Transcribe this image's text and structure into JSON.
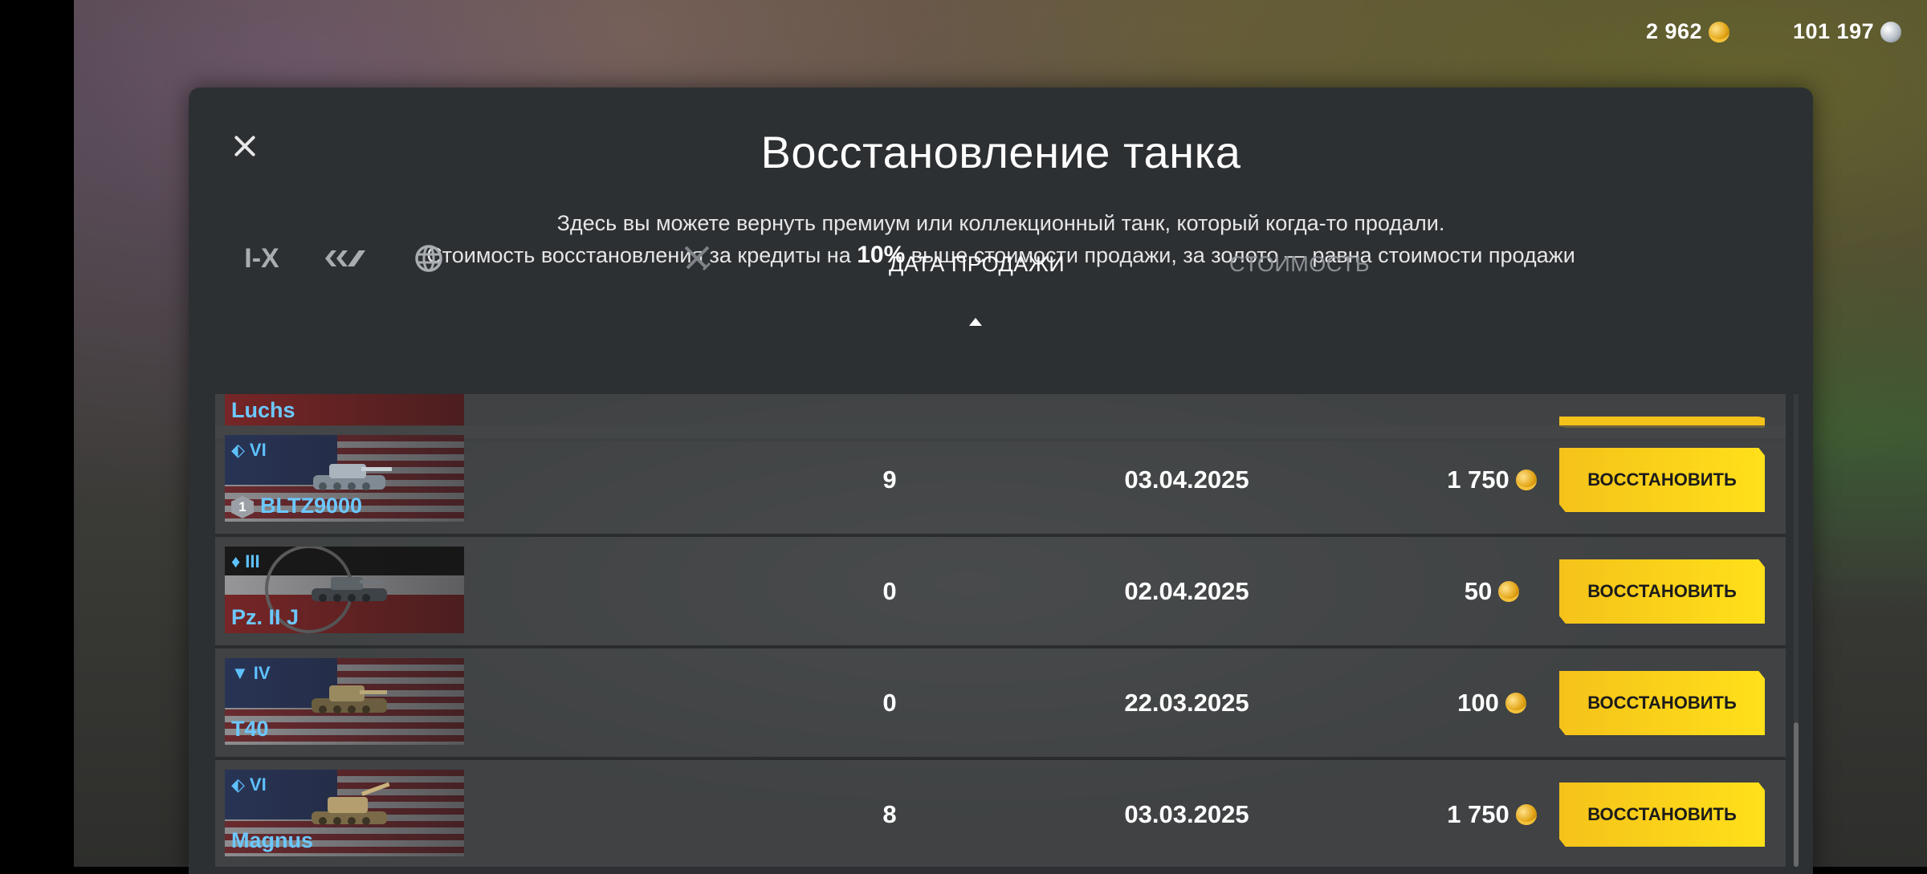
{
  "header": {
    "gold_amount": "2 962",
    "silver_amount": "101 197"
  },
  "dialog": {
    "title": "Восстановление танка",
    "description_line1": "Здесь вы можете вернуть премиум или коллекционный танк, который когда-то продали.",
    "description_line2_before": "Стоимость восстановления за кредиты на ",
    "description_line2_bold": "10%",
    "description_line2_after": " выше стоимости продажи, за золото — равна стоимости продажи"
  },
  "filters": {
    "tier_filter": "I-X"
  },
  "columns": {
    "date": "ДАТА ПРОДАЖИ",
    "price": "СТОИМОСТЬ"
  },
  "partial_row": {
    "name": "Luchs"
  },
  "rows": [
    {
      "tier": "VI",
      "name": "BLTZ9000",
      "mastery": "1",
      "battles": "9",
      "date": "03.04.2025",
      "price": "1 750",
      "button": "ВОССТАНОВИТЬ"
    },
    {
      "tier": "III",
      "name": "Pz. II J",
      "battles": "0",
      "date": "02.04.2025",
      "price": "50",
      "button": "ВОССТАНОВИТЬ"
    },
    {
      "tier": "IV",
      "name": "T40",
      "battles": "0",
      "date": "22.03.2025",
      "price": "100",
      "button": "ВОССТАНОВИТЬ"
    },
    {
      "tier": "VI",
      "name": "Magnus",
      "battles": "8",
      "date": "03.03.2025",
      "price": "1 750",
      "button": "ВОССТАНОВИТЬ"
    }
  ],
  "colors": {
    "accent_yellow": "#f5c21a",
    "tank_name_blue": "#6cc8ff",
    "dialog_bg": "#2d3033"
  }
}
